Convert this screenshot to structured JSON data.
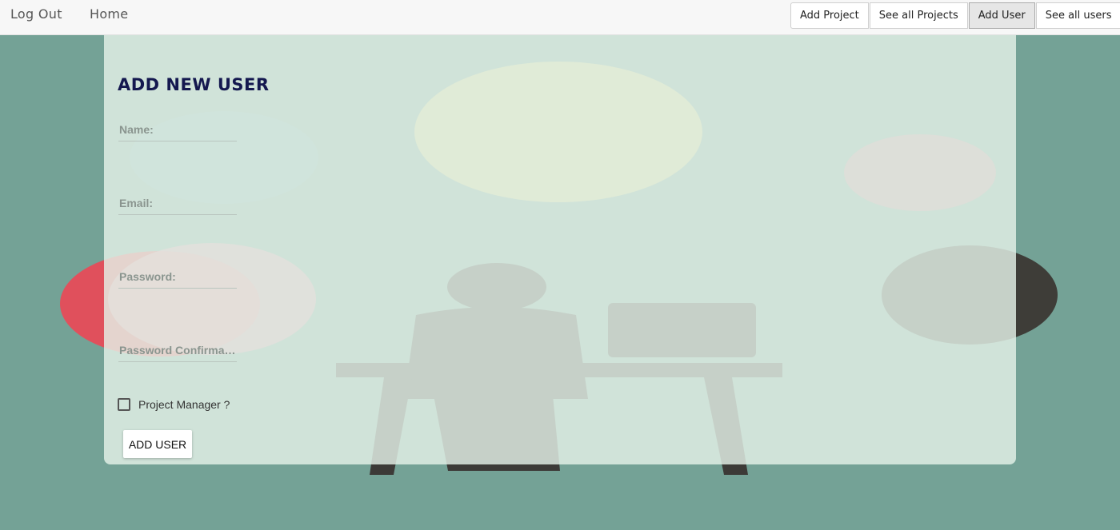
{
  "nav": {
    "left_links": [
      "Log Out",
      "Home"
    ],
    "buttons": [
      {
        "label": "Add Project",
        "active": false
      },
      {
        "label": "See all Projects",
        "active": false
      },
      {
        "label": "Add User",
        "active": true
      },
      {
        "label": "See all users",
        "active": false
      }
    ]
  },
  "form": {
    "title": "ADD NEW USER",
    "fields": {
      "name": {
        "placeholder": "Name:",
        "value": ""
      },
      "email": {
        "placeholder": "Email:",
        "value": ""
      },
      "password": {
        "placeholder": "Password:",
        "value": ""
      },
      "password_confirmation": {
        "placeholder": "Password Confirmation:",
        "value": ""
      }
    },
    "checkbox": {
      "label": "Project Manager ?",
      "checked": false
    },
    "submit_label": "ADD USER"
  },
  "colors": {
    "background": "#74a296",
    "title": "#14184f",
    "navbar": "#f7f7f7"
  }
}
